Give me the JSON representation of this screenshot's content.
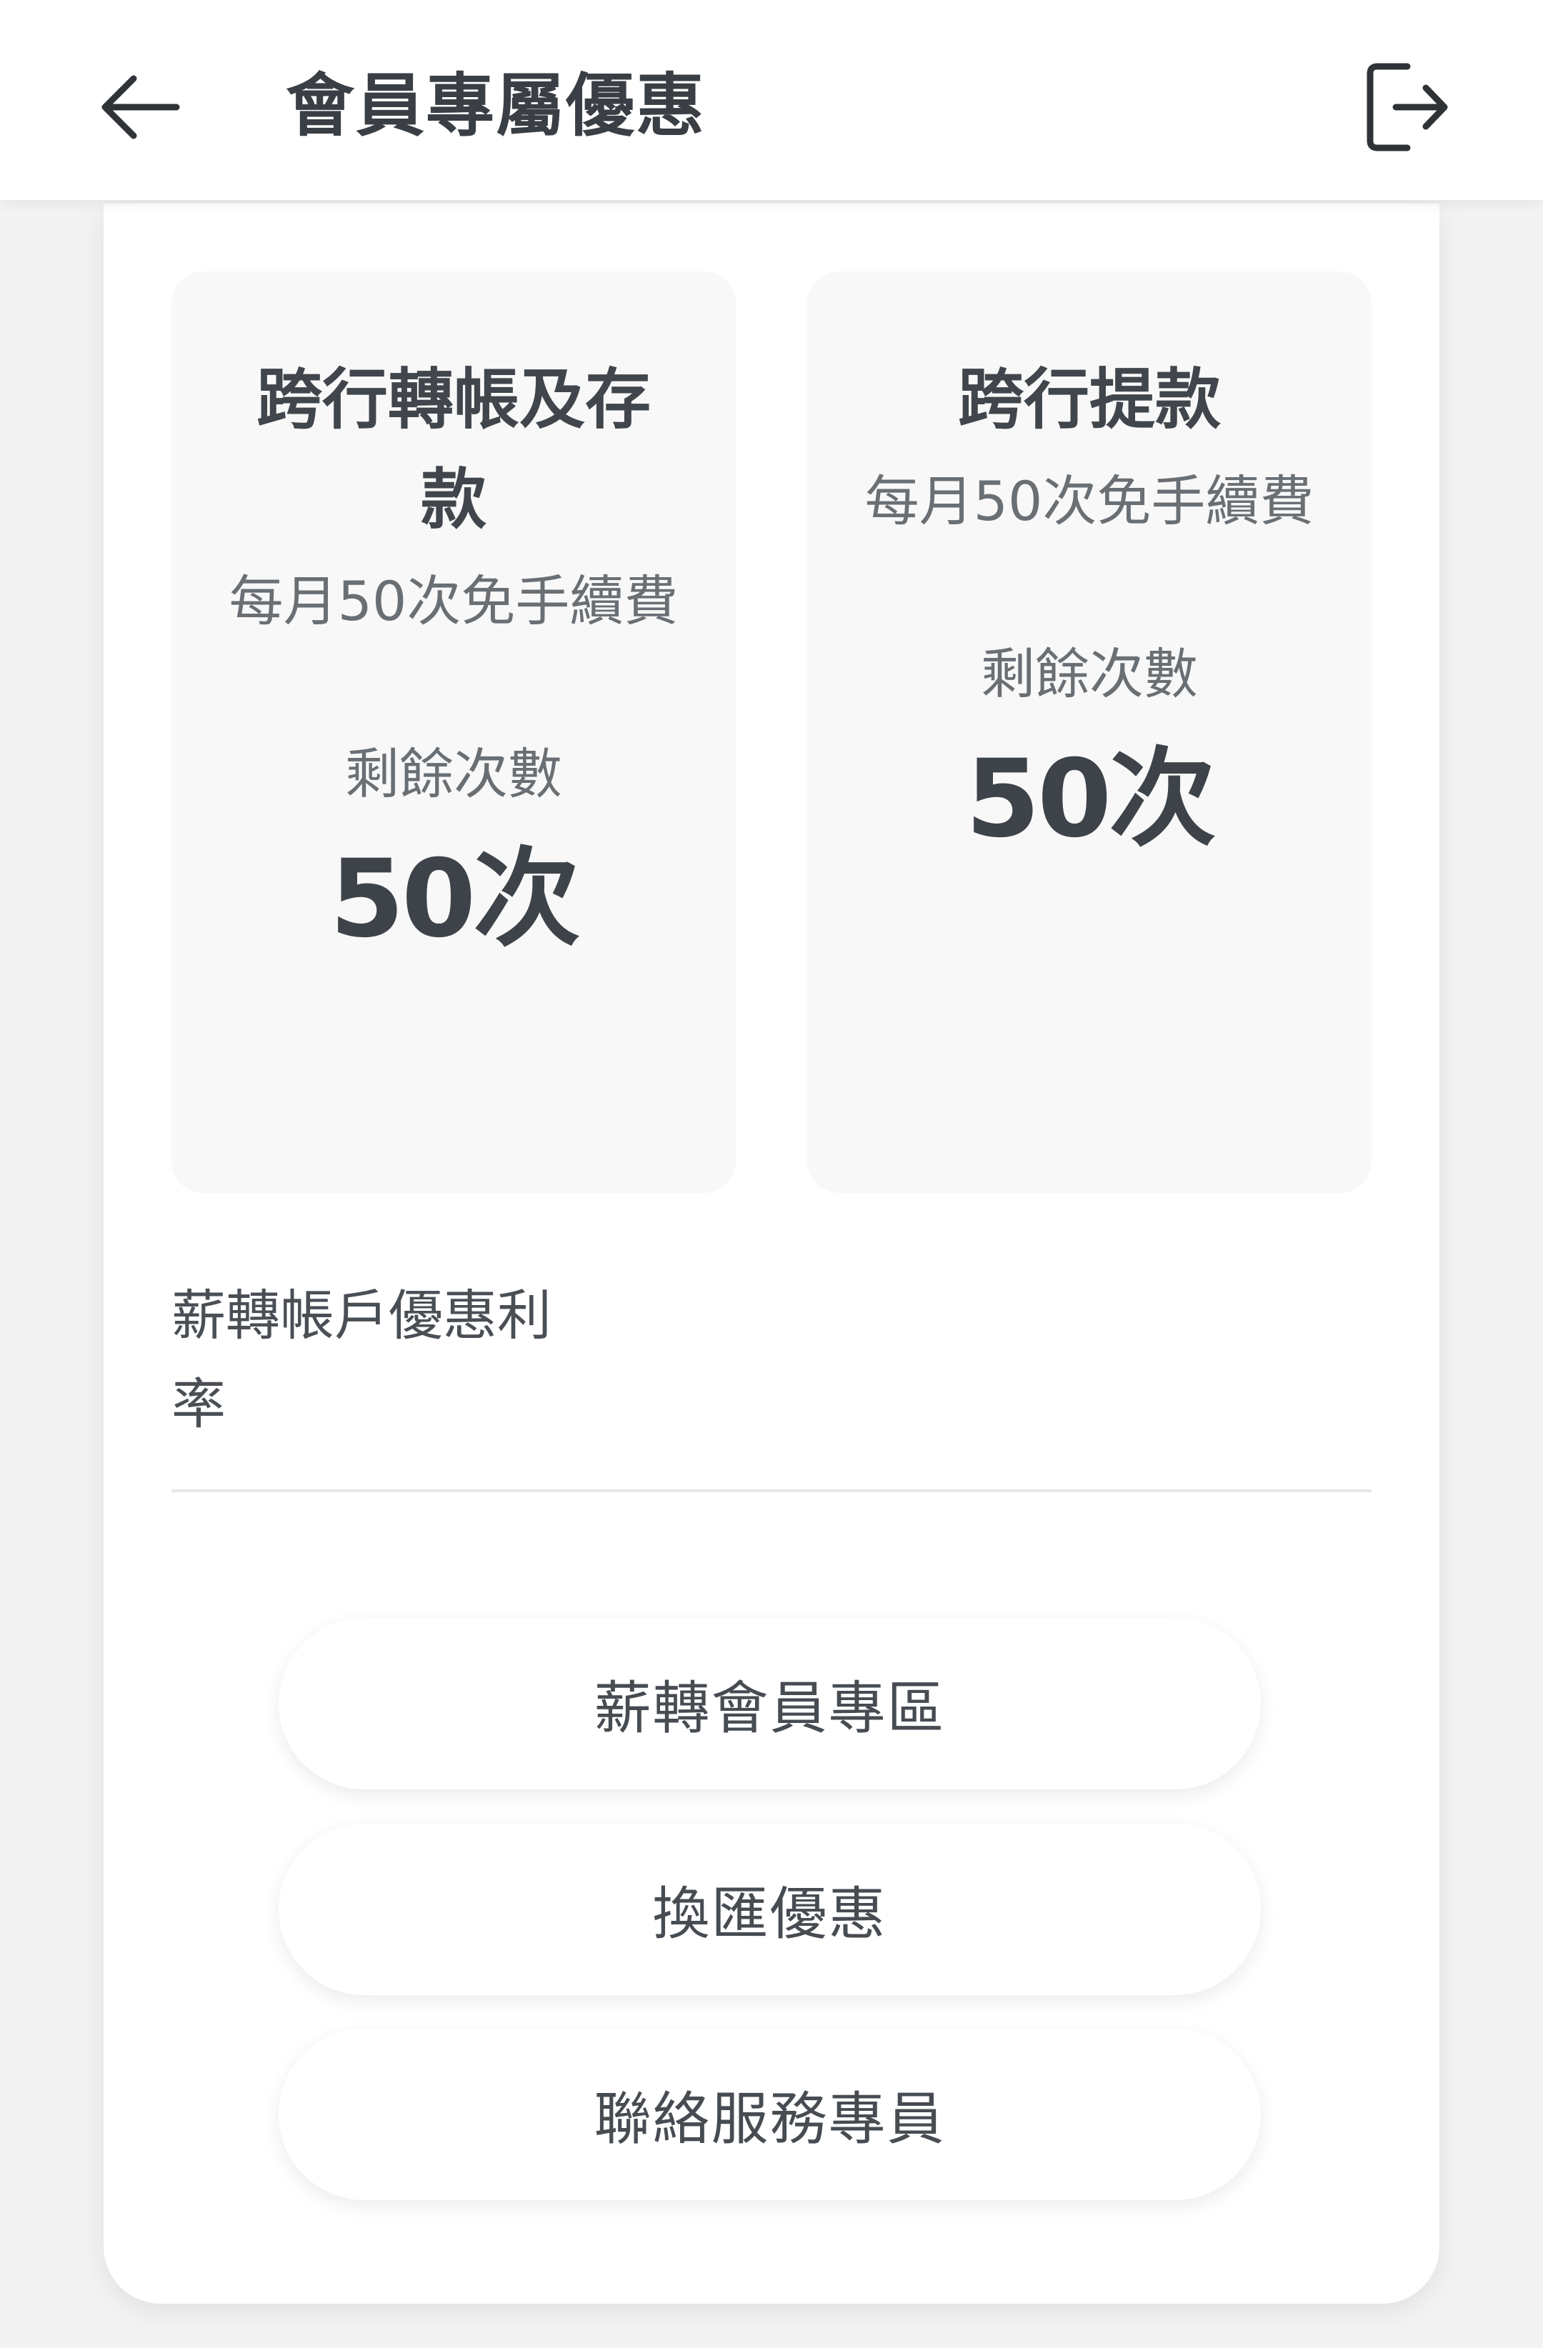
{
  "header": {
    "title": "會員專屬優惠"
  },
  "benefits": [
    {
      "title": "跨行轉帳及存款",
      "description": "每月50次免手續費",
      "remaining_label": "剩餘次數",
      "remaining_count": "50次"
    },
    {
      "title": "跨行提款",
      "description": "每月50次免手續費",
      "remaining_label": "剩餘次數",
      "remaining_count": "50次"
    }
  ],
  "rate": {
    "label": "薪轉帳戶優惠利率"
  },
  "actions": [
    {
      "label": "薪轉會員專區"
    },
    {
      "label": "換匯優惠"
    },
    {
      "label": "聯絡服務專員"
    }
  ],
  "icons": {
    "back": "arrow-left-icon",
    "logout": "logout-icon"
  },
  "colors": {
    "text_primary": "#3d4349",
    "text_secondary": "#6a6f74",
    "card_bg": "#ffffff",
    "tile_bg": "#f8f8f8",
    "page_bg": "#f3f3f4"
  }
}
